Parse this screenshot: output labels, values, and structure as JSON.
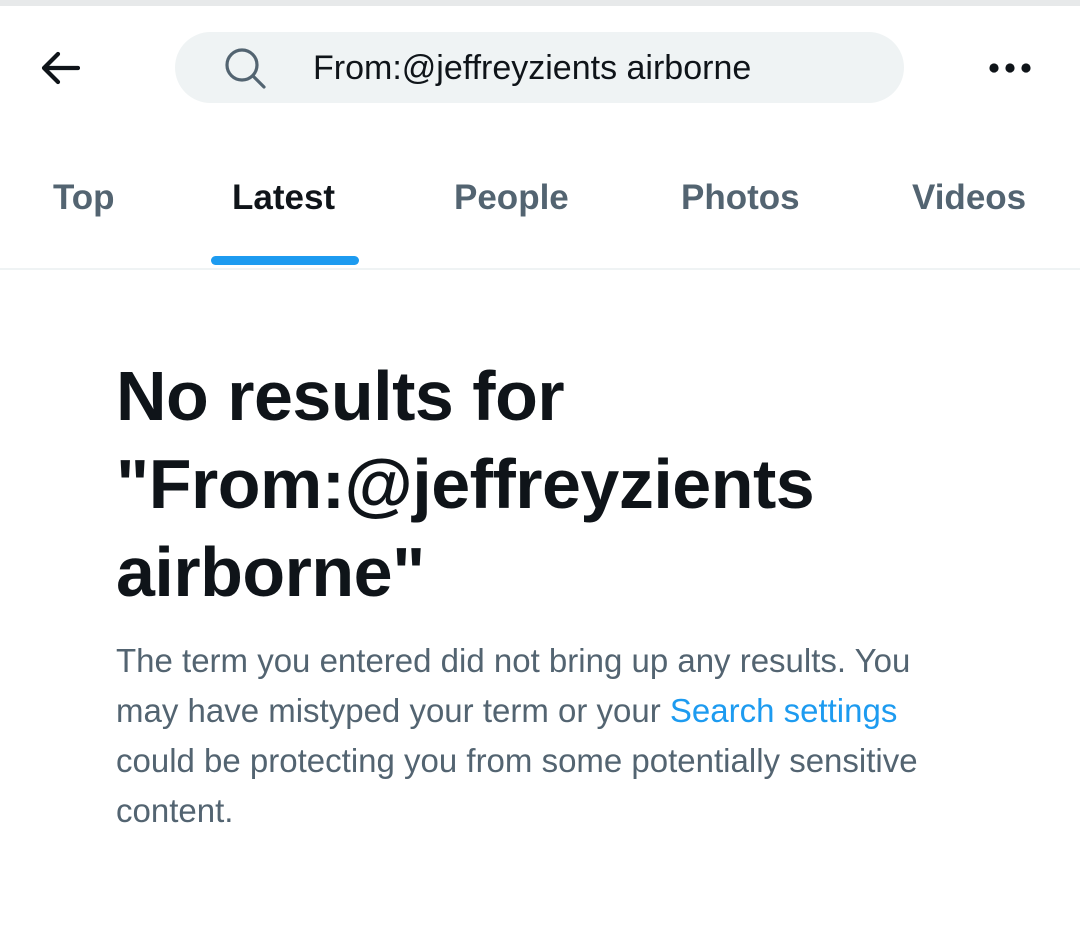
{
  "header": {
    "back_icon": "arrow-left-icon",
    "search": {
      "icon": "search-icon",
      "value": "From:@jeffreyzients airborne"
    },
    "more_icon": "more-horizontal-icon"
  },
  "tabs": [
    {
      "label": "Top",
      "active": false
    },
    {
      "label": "Latest",
      "active": true
    },
    {
      "label": "People",
      "active": false
    },
    {
      "label": "Photos",
      "active": false
    },
    {
      "label": "Videos",
      "active": false
    }
  ],
  "empty_state": {
    "title_line1": "No results for",
    "title_line2": "\"From:@jeffreyzients",
    "title_line3": "airborne\"",
    "body_part1": "The term you entered did not bring up any results. You may have mistyped your term or your ",
    "link_text": "Search settings",
    "body_part2": " could be protecting you from some potentially sensitive content."
  },
  "colors": {
    "accent": "#1d9bf0",
    "text_primary": "#0f1419",
    "text_secondary": "#536471",
    "search_bg": "#eff3f4"
  }
}
